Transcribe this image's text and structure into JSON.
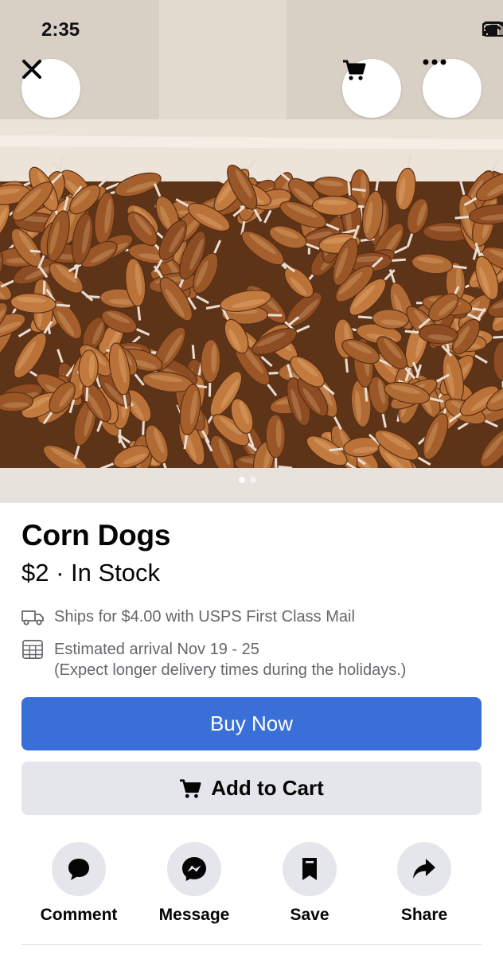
{
  "status_bar": {
    "time": "2:35"
  },
  "header": {
    "close_icon": "close-icon",
    "cart_icon": "cart-icon",
    "more_icon": "more-icon"
  },
  "listing": {
    "title": "Corn Dogs",
    "price_status": "$2 · In Stock",
    "shipping": "Ships for $4.00 with USPS First Class Mail",
    "arrival": "Estimated arrival Nov 19 - 25",
    "arrival_note": "(Expect longer delivery times during the holidays.)",
    "image_count": 2,
    "image_index": 1
  },
  "buttons": {
    "buy_now": "Buy Now",
    "add_to_cart": "Add to Cart"
  },
  "actions": [
    {
      "label": "Comment",
      "icon": "comment-icon"
    },
    {
      "label": "Message",
      "icon": "messenger-icon"
    },
    {
      "label": "Save",
      "icon": "bookmark-icon"
    },
    {
      "label": "Share",
      "icon": "share-icon"
    }
  ],
  "colors": {
    "primary": "#3a6fd8",
    "secondary_bg": "#e4e6eb",
    "muted_text": "#65676b"
  }
}
